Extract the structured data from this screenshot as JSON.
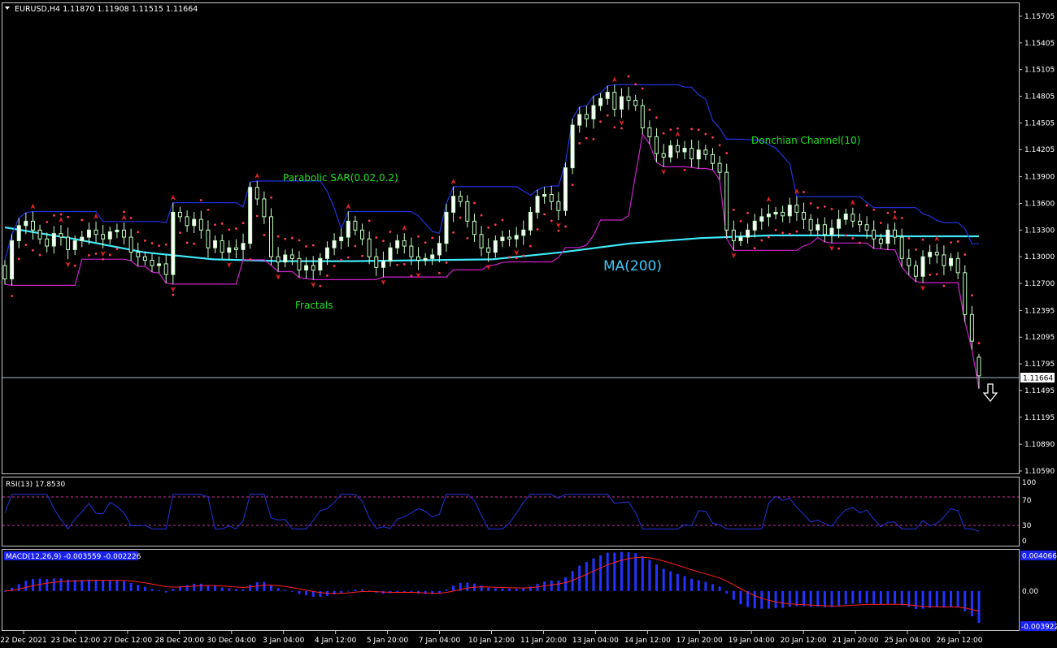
{
  "window": {
    "header": "EURUSD,H4  1.11870 1.11908 1.11515 1.11664"
  },
  "annotations": {
    "psar": "Parabolic SAR(0.02,0.2)",
    "donchian": "Donchian Channel(10)",
    "ma": "MA(200)",
    "fractals": "Fractals"
  },
  "price_axis": {
    "ticks": [
      "1.15705",
      "1.15405",
      "1.15105",
      "1.14805",
      "1.14505",
      "1.14205",
      "1.13900",
      "1.13600",
      "1.13300",
      "1.13000",
      "1.12700",
      "1.12395",
      "1.12095",
      "1.11795",
      "1.11495",
      "1.11195",
      "1.10890",
      "1.10590"
    ],
    "current_price_label": "1.11664"
  },
  "rsi": {
    "label": "RSI(13) 17.8530",
    "levels": [
      "100",
      "70",
      "30",
      "0"
    ]
  },
  "macd": {
    "label": "MACD(12,26,9) -0.003559 -0.002226",
    "ticks": [
      "0.004066",
      "0.00",
      "-0.003922"
    ]
  },
  "time_axis": [
    "22 Dec 2021",
    "23 Dec 12:00",
    "27 Dec 12:00",
    "28 Dec 20:00",
    "30 Dec 04:00",
    "3 Jan 04:00",
    "4 Jan 12:00",
    "5 Jan 20:00",
    "7 Jan 04:00",
    "10 Jan 12:00",
    "11 Jan 20:00",
    "13 Jan 04:00",
    "14 Jan 12:00",
    "17 Jan 20:00",
    "19 Jan 04:00",
    "20 Jan 12:00",
    "21 Jan 20:00",
    "25 Jan 04:00",
    "26 Jan 12:00"
  ],
  "colors": {
    "candle_bull": "#ffffff",
    "candle_bear": "#c0ffc0",
    "psar": "#ff3c50",
    "donchian_upper": "#2233dd",
    "donchian_lower": "#cc22cc",
    "ma200": "#40e8f8",
    "fractal": "#e02020",
    "rsi_line": "#2233dd",
    "macd_hist": "#2233ff",
    "macd_signal": "#ff2020",
    "label_green": "#20e020",
    "label_cyan": "#40c8f8"
  },
  "chart_data": {
    "type": "line",
    "symbol": "EURUSD",
    "timeframe": "H4",
    "ohlc_last": {
      "open": 1.1187,
      "high": 1.11908,
      "low": 1.11515,
      "close": 1.11664
    },
    "close_series": [
      1.1275,
      1.1318,
      1.1335,
      1.134,
      1.133,
      1.132,
      1.1312,
      1.1326,
      1.1322,
      1.1308,
      1.1318,
      1.1322,
      1.133,
      1.1325,
      1.132,
      1.1328,
      1.133,
      1.1322,
      1.1305,
      1.13,
      1.1296,
      1.129,
      1.1292,
      1.128,
      1.135,
      1.1345,
      1.1335,
      1.1342,
      1.133,
      1.131,
      1.1318,
      1.1305,
      1.131,
      1.1308,
      1.1315,
      1.1378,
      1.1365,
      1.1345,
      1.13,
      1.1294,
      1.1302,
      1.1298,
      1.1285,
      1.129,
      1.1285,
      1.1298,
      1.131,
      1.1318,
      1.1322,
      1.134,
      1.133,
      1.132,
      1.13,
      1.1288,
      1.1295,
      1.131,
      1.1318,
      1.1312,
      1.13,
      1.1296,
      1.1298,
      1.1302,
      1.1315,
      1.135,
      1.1368,
      1.1362,
      1.134,
      1.1325,
      1.131,
      1.1305,
      1.1318,
      1.1322,
      1.132,
      1.1324,
      1.133,
      1.135,
      1.1368,
      1.137,
      1.1362,
      1.1352,
      1.14,
      1.1448,
      1.146,
      1.1455,
      1.147,
      1.1478,
      1.1485,
      1.1466,
      1.148,
      1.1476,
      1.147,
      1.1445,
      1.1435,
      1.1416,
      1.1412,
      1.1425,
      1.1418,
      1.1422,
      1.141,
      1.142,
      1.1415,
      1.1405,
      1.1395,
      1.133,
      1.1318,
      1.1322,
      1.133,
      1.134,
      1.1345,
      1.1348,
      1.135,
      1.1346,
      1.1358,
      1.135,
      1.1342,
      1.133,
      1.1336,
      1.1325,
      1.1332,
      1.1342,
      1.1348,
      1.134,
      1.1336,
      1.133,
      1.132,
      1.1315,
      1.133,
      1.1322,
      1.1298,
      1.129,
      1.1278,
      1.13,
      1.1305,
      1.1302,
      1.129,
      1.1298,
      1.1282,
      1.1235,
      1.1205,
      1.1166
    ],
    "ma200": [
      1.1333,
      1.132,
      1.1305,
      1.1297,
      1.1295,
      1.1295,
      1.1296,
      1.1297,
      1.1305,
      1.1315,
      1.1321,
      1.1324,
      1.1324,
      1.1323,
      1.1323
    ],
    "rsi_value": 17.853,
    "rsi_levels": [
      70,
      30
    ],
    "rsi_ylim": [
      0,
      100
    ],
    "macd": {
      "main": -0.003559,
      "signal": -0.002226,
      "ylim": [
        -0.003922,
        0.004066
      ]
    },
    "price_ylim": [
      1.1059,
      1.15705
    ],
    "annotations": [
      "Parabolic SAR(0.02,0.2)",
      "Donchian Channel(10)",
      "MA(200)",
      "Fractals"
    ]
  }
}
